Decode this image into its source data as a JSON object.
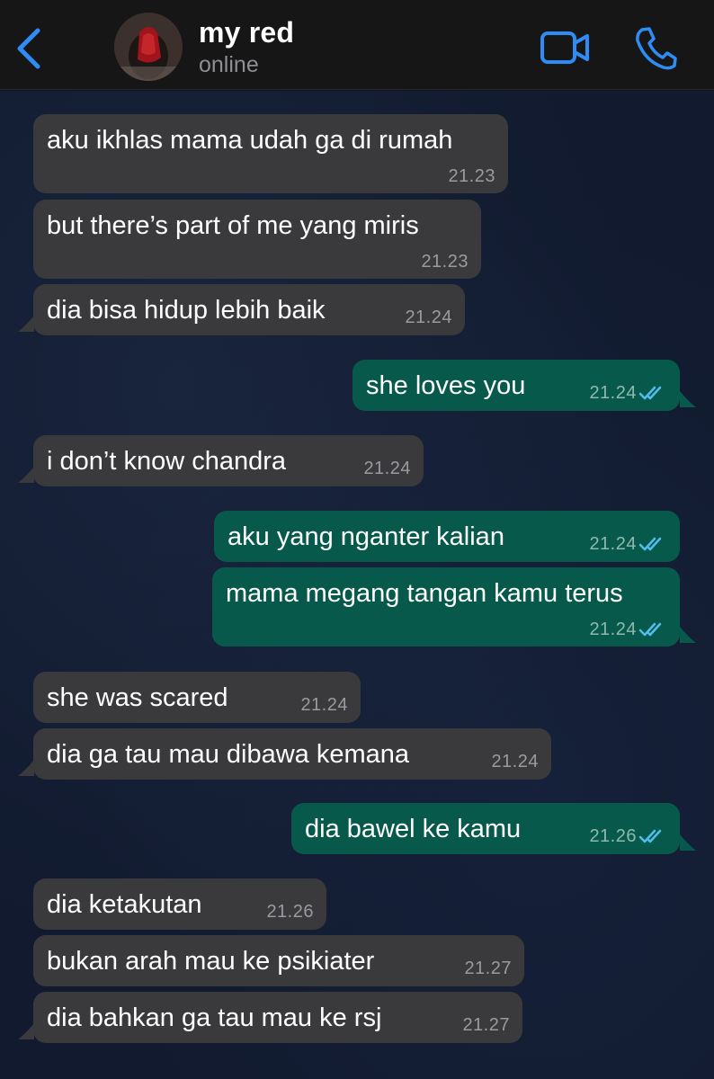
{
  "header": {
    "contact_name": "my red",
    "contact_status": "online",
    "icons": {
      "back": "chevron-left-icon",
      "video": "video-camera-icon",
      "call": "phone-icon"
    },
    "accent_color": "#2f8cf5"
  },
  "colors": {
    "incoming_bubble": "#3a3a3c",
    "outgoing_bubble": "#075a4b",
    "read_ticks": "#53bdeb"
  },
  "messages": [
    {
      "direction": "in",
      "text": "aku ikhlas mama udah ga di rumah",
      "time": "21.23"
    },
    {
      "direction": "in",
      "text": "but there’s part of me yang miris",
      "time": "21.23"
    },
    {
      "direction": "in",
      "text": "dia bisa hidup lebih baik",
      "time": "21.24"
    },
    {
      "direction": "out",
      "text": "she loves you",
      "time": "21.24",
      "status": "read"
    },
    {
      "direction": "in",
      "text": "i don’t know chandra",
      "time": "21.24"
    },
    {
      "direction": "out",
      "text": "aku yang nganter kalian",
      "time": "21.24",
      "status": "read"
    },
    {
      "direction": "out",
      "text": "mama megang tangan kamu terus",
      "time": "21.24",
      "status": "read"
    },
    {
      "direction": "in",
      "text": "she was scared",
      "time": "21.24"
    },
    {
      "direction": "in",
      "text": "dia ga tau mau dibawa kemana",
      "time": "21.24"
    },
    {
      "direction": "out",
      "text": "dia bawel ke kamu",
      "time": "21.26",
      "status": "read"
    },
    {
      "direction": "in",
      "text": "dia ketakutan",
      "time": "21.26"
    },
    {
      "direction": "in",
      "text": "bukan arah mau ke psikiater",
      "time": "21.27"
    },
    {
      "direction": "in",
      "text": "dia bahkan ga tau mau ke rsj",
      "time": "21.27"
    }
  ]
}
